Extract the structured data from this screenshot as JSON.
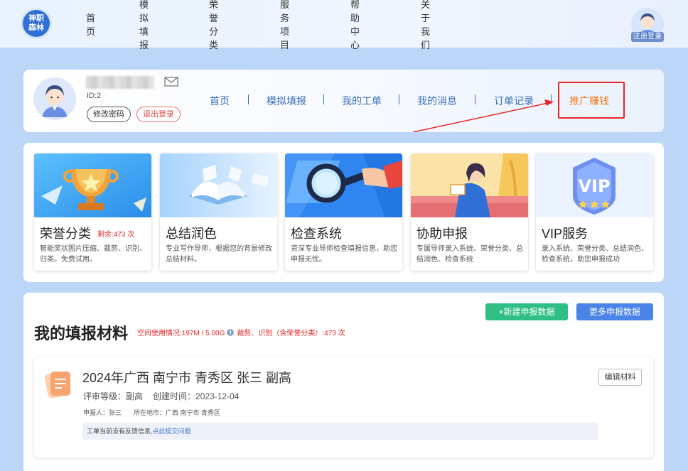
{
  "site": {
    "logo_text": "神职森林"
  },
  "topnav": {
    "items": [
      "首页",
      "模拟填报",
      "荣誉分类",
      "服务项目",
      "帮助中心",
      "关于我们"
    ],
    "login_label": "注册登录"
  },
  "user": {
    "name": "■■■■■■",
    "id_label": "ID:2",
    "change_password": "修改密码",
    "logout": "退出登录"
  },
  "subnav": {
    "items": [
      "首页",
      "模拟填报",
      "我的工单",
      "我的消息",
      "订单记录",
      "推广赚钱"
    ]
  },
  "services": [
    {
      "title": "荣誉分类",
      "remain": "剩余:473 次",
      "desc": "智能奖状图片压缩、裁剪、识别、归类。免费试用。"
    },
    {
      "title": "总结润色",
      "remain": "",
      "desc": "专业写作导师，根据您的背景修改总结材料。"
    },
    {
      "title": "检查系统",
      "remain": "",
      "desc": "资深专业导师检查填报信息，助您申报无忧。"
    },
    {
      "title": "协助申报",
      "remain": "",
      "desc": "专属导师录入系统、荣誉分类、总结润色、检查系统"
    },
    {
      "title": "VIP服务",
      "remain": "",
      "desc": "录入系统、荣誉分类、总结润色、检查系统，助您申报成功"
    }
  ],
  "materials": {
    "title": "我的填报材料",
    "usage_prefix": "空间使用情况:197M / 5.00G",
    "usage_suffix": "裁剪、识别（含荣誉分类）:473 次",
    "new_button": "+新建申报数据",
    "more_button": "更多申报数据",
    "record": {
      "title": "2024年广西 南宁市 青秀区 张三 副高",
      "level": "评审等级：副高",
      "created": "创建时间：2023-12-04",
      "applicant": "申报人：张三",
      "location": "所在地市：广西 南宁市 青秀区",
      "feedback_text": "工单当前没有反馈信息,",
      "feedback_link": "点此提交问题",
      "edit_button": "编辑材料"
    }
  },
  "colors": {
    "page_bg": "#bcd6f7",
    "link_blue": "#3a6fb8",
    "promo_orange": "#f07a1f",
    "highlight_red": "#e52626",
    "green_button": "#2fbf84",
    "blue_button": "#4a84e8"
  }
}
